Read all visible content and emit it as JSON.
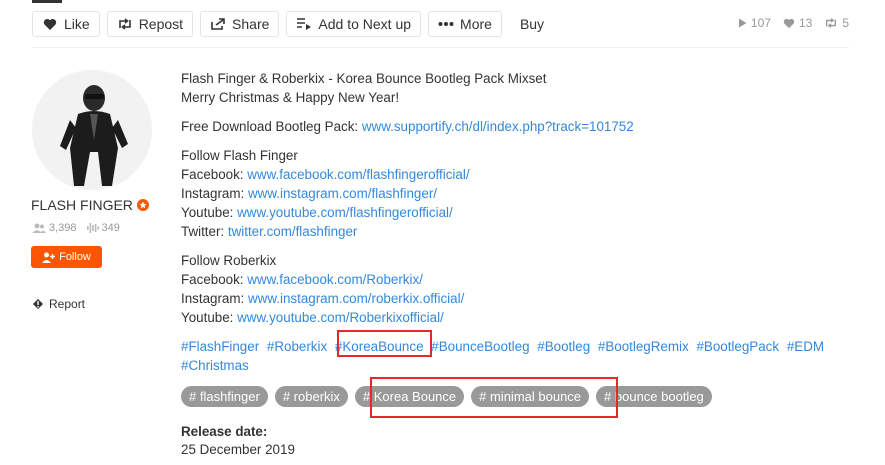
{
  "actions": {
    "like": "Like",
    "repost": "Repost",
    "share": "Share",
    "add_next": "Add to Next up",
    "more": "More",
    "buy": "Buy"
  },
  "stats": {
    "plays": "107",
    "likes": "13",
    "reposts": "5"
  },
  "user": {
    "name": "FLASH FINGER",
    "followers": "3,398",
    "tracks": "349",
    "follow_label": "Follow",
    "report_label": "Report"
  },
  "description": {
    "title": "Flash Finger & Roberkix - Korea Bounce Bootleg Pack Mixset",
    "greeting": "Merry Christmas & Happy New Year!",
    "download_label": "Free Download Bootleg Pack: ",
    "download_link": "www.supportify.ch/dl/index.php?track=101752",
    "follow_ff_heading": "Follow Flash Finger",
    "ff_links": [
      {
        "label": "Facebook: ",
        "url": "www.facebook.com/flashfingerofficial/"
      },
      {
        "label": "Instagram: ",
        "url": "www.instagram.com/flashfinger/"
      },
      {
        "label": "Youtube: ",
        "url": "www.youtube.com/flashfingerofficial/"
      },
      {
        "label": "Twitter: ",
        "url": "twitter.com/flashfinger"
      }
    ],
    "follow_rk_heading": "Follow Roberkix",
    "rk_links": [
      {
        "label": "Facebook: ",
        "url": "www.facebook.com/Roberkix/"
      },
      {
        "label": "Instagram: ",
        "url": "www.instagram.com/roberkix.official/"
      },
      {
        "label": "Youtube: ",
        "url": "www.youtube.com/Roberkixofficial/"
      }
    ],
    "hashtags": [
      "#FlashFinger",
      "#Roberkix",
      "#KoreaBounce",
      "#BounceBootleg",
      "#Bootleg",
      "#BootlegRemix",
      "#BootlegPack",
      "#EDM",
      "#Christmas"
    ]
  },
  "tags": [
    "# flashfinger",
    "# roberkix",
    "# Korea Bounce",
    "# minimal bounce",
    "# bounce bootleg"
  ],
  "release": {
    "label": "Release date:",
    "date": "25 December 2019"
  },
  "colors": {
    "accent": "#ff5500",
    "link": "#3388dd",
    "highlight": "#e8272d",
    "tag_bg": "#999999"
  }
}
